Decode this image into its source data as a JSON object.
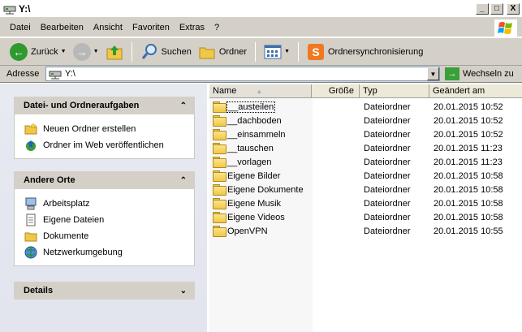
{
  "window": {
    "title": "Y:\\",
    "minimize": "_",
    "maximize": "□",
    "close": "X"
  },
  "menu": [
    {
      "label": "Datei"
    },
    {
      "label": "Bearbeiten"
    },
    {
      "label": "Ansicht"
    },
    {
      "label": "Favoriten"
    },
    {
      "label": "Extras"
    },
    {
      "label": "?"
    }
  ],
  "toolbar": {
    "back_label": "Zurück",
    "search_label": "Suchen",
    "folders_label": "Ordner",
    "sync_label": "Ordnersynchronisierung"
  },
  "address": {
    "label": "Adresse",
    "value": "Y:\\",
    "go_label": "Wechseln zu"
  },
  "panels": {
    "tasks": {
      "title": "Datei- und Ordneraufgaben",
      "items": [
        {
          "label": "Neuen Ordner erstellen",
          "icon": "new-folder-icon"
        },
        {
          "label": "Ordner im Web veröffentlichen",
          "icon": "publish-web-icon"
        }
      ]
    },
    "places": {
      "title": "Andere Orte",
      "items": [
        {
          "label": "Arbeitsplatz",
          "icon": "my-computer-icon"
        },
        {
          "label": "Eigene Dateien",
          "icon": "my-documents-icon"
        },
        {
          "label": "Dokumente",
          "icon": "folder-icon"
        },
        {
          "label": "Netzwerkumgebung",
          "icon": "network-icon"
        }
      ]
    },
    "details": {
      "title": "Details"
    }
  },
  "columns": {
    "name": "Name",
    "size": "Größe",
    "type": "Typ",
    "date": "Geändert am"
  },
  "files": [
    {
      "name": "__austeilen",
      "type": "Dateiordner",
      "date": "20.01.2015 10:52"
    },
    {
      "name": "__dachboden",
      "type": "Dateiordner",
      "date": "20.01.2015 10:52"
    },
    {
      "name": "__einsammeln",
      "type": "Dateiordner",
      "date": "20.01.2015 10:52"
    },
    {
      "name": "__tauschen",
      "type": "Dateiordner",
      "date": "20.01.2015 11:23"
    },
    {
      "name": "__vorlagen",
      "type": "Dateiordner",
      "date": "20.01.2015 11:23"
    },
    {
      "name": "Eigene Bilder",
      "type": "Dateiordner",
      "date": "20.01.2015 10:58"
    },
    {
      "name": "Eigene Dokumente",
      "type": "Dateiordner",
      "date": "20.01.2015 10:58"
    },
    {
      "name": "Eigene Musik",
      "type": "Dateiordner",
      "date": "20.01.2015 10:58"
    },
    {
      "name": "Eigene Videos",
      "type": "Dateiordner",
      "date": "20.01.2015 10:58"
    },
    {
      "name": "OpenVPN",
      "type": "Dateiordner",
      "date": "20.01.2015 10:55"
    }
  ]
}
